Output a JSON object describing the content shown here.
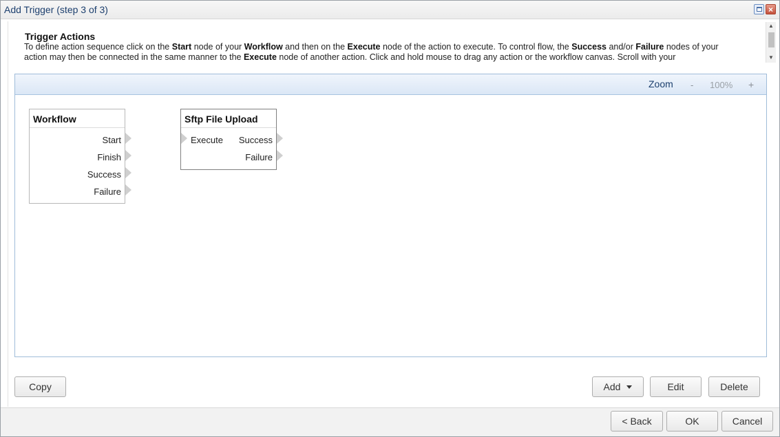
{
  "window": {
    "title": "Add Trigger (step 3 of 3)"
  },
  "header": {
    "section_title": "Trigger Actions",
    "description": [
      {
        "t": "To define action sequence click on the "
      },
      {
        "t": "Start",
        "b": true
      },
      {
        "t": " node of your "
      },
      {
        "t": "Workflow",
        "b": true
      },
      {
        "t": " and then on the "
      },
      {
        "t": "Execute",
        "b": true
      },
      {
        "t": " node of the action to execute. To control flow, the "
      },
      {
        "t": "Success",
        "b": true
      },
      {
        "t": " and/or "
      },
      {
        "t": "Failure",
        "b": true
      },
      {
        "t": " nodes of your action may then be connected in the same manner to the "
      },
      {
        "t": "Execute",
        "b": true
      },
      {
        "t": " node of another action. Click and hold mouse to drag any action or the workflow canvas. Scroll with your"
      }
    ]
  },
  "zoom": {
    "label": "Zoom",
    "minus": "-",
    "value": "100%",
    "plus": "+"
  },
  "nodes": {
    "workflow": {
      "title": "Workflow",
      "ports": [
        "Start",
        "Finish",
        "Success",
        "Failure"
      ]
    },
    "sftp": {
      "title": "Sftp File Upload",
      "input": "Execute",
      "outputs": [
        "Success",
        "Failure"
      ]
    }
  },
  "actions": {
    "copy": "Copy",
    "add": "Add",
    "edit": "Edit",
    "delete": "Delete"
  },
  "footer": {
    "back": "< Back",
    "ok": "OK",
    "cancel": "Cancel"
  }
}
